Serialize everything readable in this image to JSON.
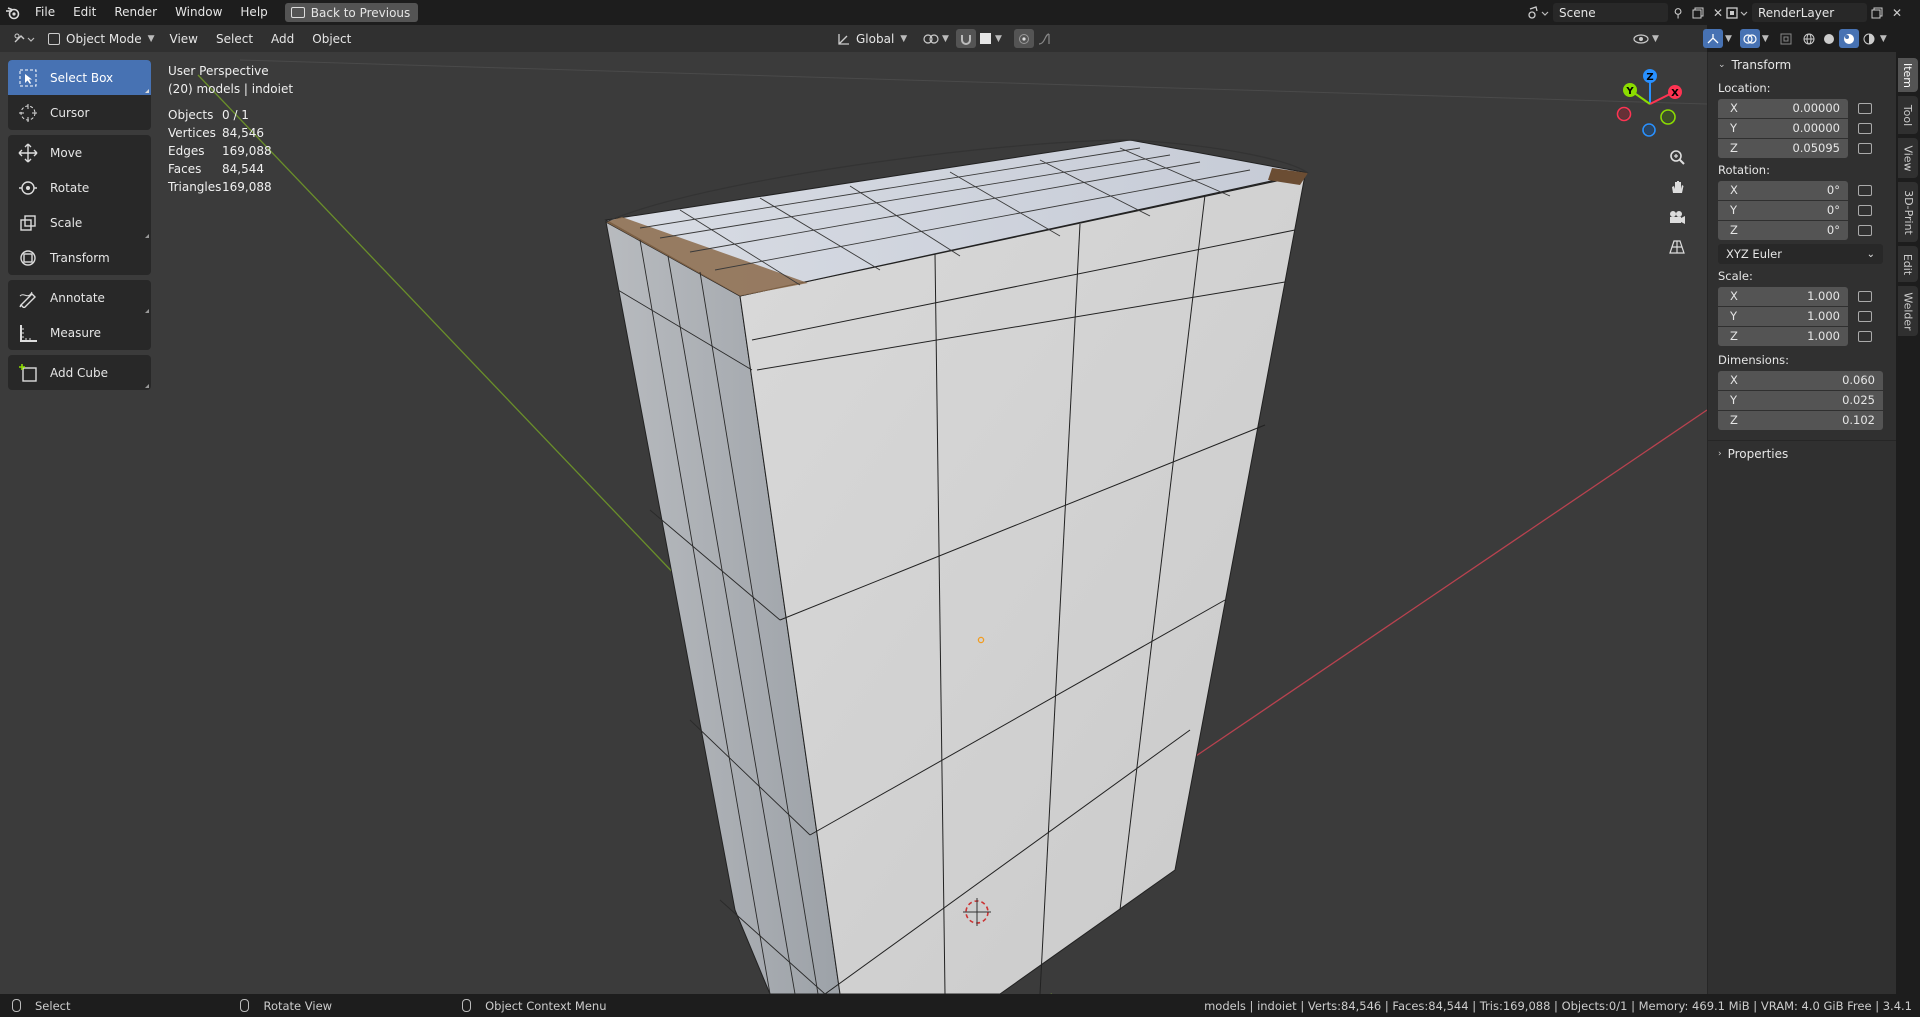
{
  "menu": {
    "items": [
      "File",
      "Edit",
      "Render",
      "Window",
      "Help"
    ],
    "back_button": "Back to Previous"
  },
  "scene": {
    "label": "Scene"
  },
  "render_layer": {
    "label": "RenderLayer"
  },
  "viewport_header": {
    "mode": "Object Mode",
    "menus": [
      "View",
      "Select",
      "Add",
      "Object"
    ],
    "orientation": "Global"
  },
  "toolbar": {
    "tools": [
      "Select Box",
      "Cursor",
      "Move",
      "Rotate",
      "Scale",
      "Transform",
      "Annotate",
      "Measure",
      "Add Cube"
    ],
    "active": "Select Box"
  },
  "overlay": {
    "perspective": "User Perspective",
    "collection": "(20) models | indoiet"
  },
  "stats": [
    {
      "label": "Objects",
      "value": "0 / 1"
    },
    {
      "label": "Vertices",
      "value": "84,546"
    },
    {
      "label": "Edges",
      "value": "169,088"
    },
    {
      "label": "Faces",
      "value": "84,544"
    },
    {
      "label": "Triangles",
      "value": "169,088"
    }
  ],
  "gizmo": {
    "x": "X",
    "y": "Y",
    "z": "Z"
  },
  "transform_panel": {
    "title": "Transform",
    "location_label": "Location:",
    "location": [
      {
        "axis": "X",
        "value": "0.00000"
      },
      {
        "axis": "Y",
        "value": "0.00000"
      },
      {
        "axis": "Z",
        "value": "0.05095"
      }
    ],
    "rotation_label": "Rotation:",
    "rotation": [
      {
        "axis": "X",
        "value": "0°"
      },
      {
        "axis": "Y",
        "value": "0°"
      },
      {
        "axis": "Z",
        "value": "0°"
      }
    ],
    "rotation_mode": "XYZ Euler",
    "scale_label": "Scale:",
    "scale": [
      {
        "axis": "X",
        "value": "1.000"
      },
      {
        "axis": "Y",
        "value": "1.000"
      },
      {
        "axis": "Z",
        "value": "1.000"
      }
    ],
    "dimensions_label": "Dimensions:",
    "dimensions": [
      {
        "axis": "X",
        "value": "0.060"
      },
      {
        "axis": "Y",
        "value": "0.025"
      },
      {
        "axis": "Z",
        "value": "0.102"
      }
    ],
    "properties_title": "Properties"
  },
  "side_tabs": [
    "Item",
    "Tool",
    "View",
    "3D-Print",
    "Edit",
    "Welder"
  ],
  "status_bar": {
    "select": "Select",
    "rotate": "Rotate View",
    "context": "Object Context Menu",
    "info": "models | indoiet | Verts:84,546 | Faces:84,544 | Tris:169,088 | Objects:0/1 | Memory: 469.1 MiB | VRAM: 4.0 GiB Free | 3.4.1"
  },
  "colors": {
    "accent": "#4772b3",
    "axis_x": "#ff3352",
    "axis_y": "#8bdc00",
    "axis_z": "#2890ff",
    "viewport_bg": "#3b3b3b",
    "mesh": "#cfcfcf"
  }
}
